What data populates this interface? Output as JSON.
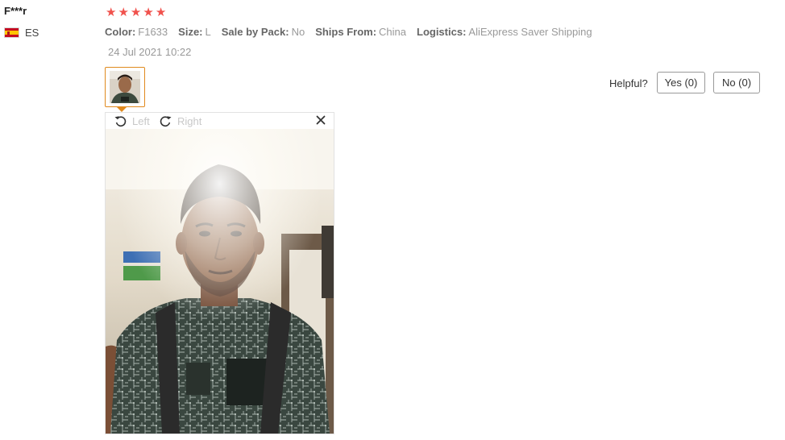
{
  "reviewer": {
    "name": "F***r",
    "country_code": "ES"
  },
  "rating": {
    "stars": 5,
    "max": 5
  },
  "sku": [
    {
      "label": "Color:",
      "value": "F1633"
    },
    {
      "label": "Size:",
      "value": "L"
    },
    {
      "label": "Sale by Pack:",
      "value": "No"
    },
    {
      "label": "Ships From:",
      "value": "China"
    },
    {
      "label": "Logistics:",
      "value": "AliExpress Saver Shipping"
    }
  ],
  "review": {
    "date": "24 Jul 2021 10:22"
  },
  "helpful": {
    "label": "Helpful?",
    "yes": "Yes (0)",
    "no": "No (0)"
  },
  "viewer": {
    "rotate_left": "Left",
    "rotate_right": "Right"
  },
  "colors": {
    "star": "#f0524d",
    "thumb_border": "#e08a1e",
    "muted_text": "#999999"
  },
  "icons": {
    "close": "close-icon",
    "rotate_left": "rotate-left-icon",
    "rotate_right": "rotate-right-icon",
    "flag": "spain-flag-icon",
    "star": "star-icon"
  }
}
